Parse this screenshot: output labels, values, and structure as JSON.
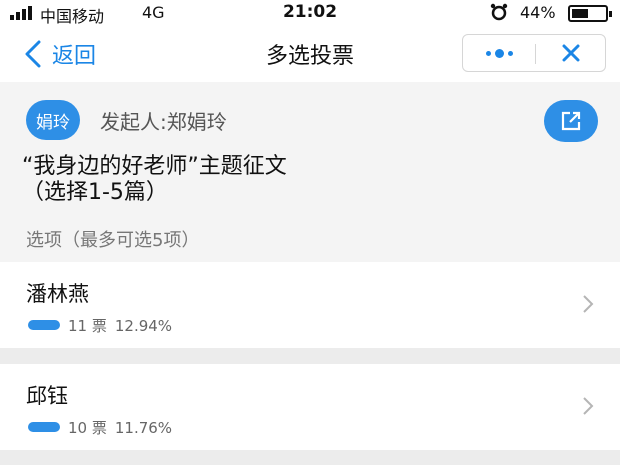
{
  "status_bar": {
    "carrier": "中国移动",
    "network": "4G",
    "time": "21:02",
    "battery": "44%",
    "icons": [
      "signal-icon",
      "alarm-icon",
      "battery-icon"
    ]
  },
  "nav": {
    "back_label": "返回",
    "title": "多选投票",
    "icons": [
      "chevron-left-icon",
      "more-icon",
      "close-icon"
    ]
  },
  "header": {
    "avatar_text": "娟玲",
    "initiator": "发起人:郑娟玲",
    "vote_title_line1": "“我身边的好老师”主题征文",
    "vote_title_line2": "（选择1-5篇）",
    "options_hint": "选项（最多可选5项）",
    "icons": [
      "share-icon"
    ]
  },
  "options": [
    {
      "name": "潘林燕",
      "votes": "11 票",
      "percent": "12.94%",
      "fraction": 0.1294
    },
    {
      "name": "邱钰",
      "votes": "10 票",
      "percent": "11.76%",
      "fraction": 0.1176
    }
  ],
  "colors": {
    "accent": "#2e8fe6",
    "link": "#1b86e6",
    "background": "#ececec"
  }
}
